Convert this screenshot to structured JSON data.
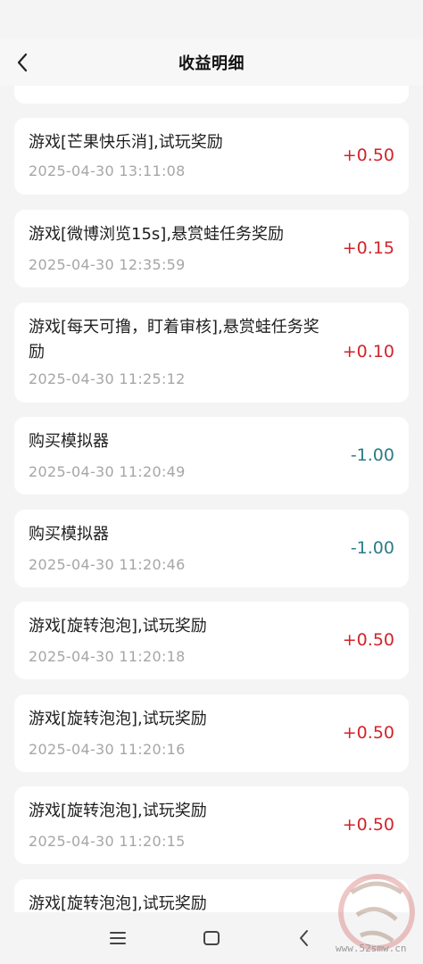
{
  "header": {
    "title": "收益明细"
  },
  "records": [
    {
      "title": "游戏[芒果快乐消],试玩奖励",
      "time": "2025-04-30 13:11:08",
      "amount": "+0.50",
      "type": "income"
    },
    {
      "title": "游戏[微博浏览15s],悬赏蛙任务奖励",
      "time": "2025-04-30 12:35:59",
      "amount": "+0.15",
      "type": "income"
    },
    {
      "title": "游戏[每天可撸，盯着审核],悬赏蛙任务奖励",
      "time": "2025-04-30 11:25:12",
      "amount": "+0.10",
      "type": "income"
    },
    {
      "title": "购买模拟器",
      "time": "2025-04-30 11:20:49",
      "amount": "-1.00",
      "type": "expense"
    },
    {
      "title": "购买模拟器",
      "time": "2025-04-30 11:20:46",
      "amount": "-1.00",
      "type": "expense"
    },
    {
      "title": "游戏[旋转泡泡],试玩奖励",
      "time": "2025-04-30 11:20:18",
      "amount": "+0.50",
      "type": "income"
    },
    {
      "title": "游戏[旋转泡泡],试玩奖励",
      "time": "2025-04-30 11:20:16",
      "amount": "+0.50",
      "type": "income"
    },
    {
      "title": "游戏[旋转泡泡],试玩奖励",
      "time": "2025-04-30 11:20:15",
      "amount": "+0.50",
      "type": "income"
    },
    {
      "title": "游戏[旋转泡泡],试玩奖励"
    }
  ],
  "colors": {
    "income": "#d2232a",
    "expense": "#2b7c8a",
    "background": "#f4f4f4",
    "card": "#ffffff"
  },
  "icons": {
    "back": "chevron-left-icon",
    "menu": "menu-icon",
    "home": "home-icon",
    "nav_back": "back-icon"
  },
  "watermark": {
    "url": "www.52smw.cn"
  }
}
